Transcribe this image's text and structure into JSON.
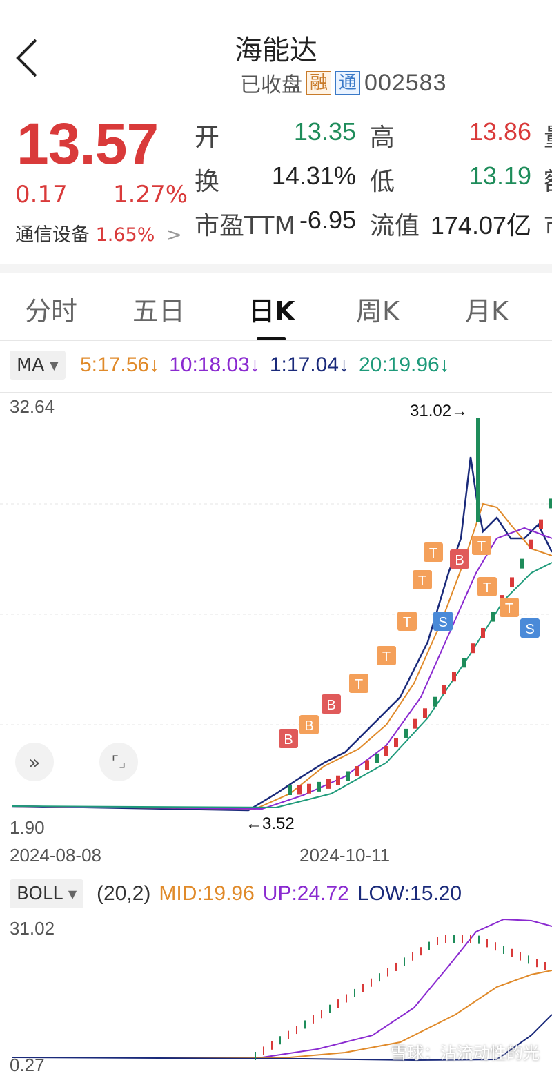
{
  "header": {
    "title": "海能达",
    "status": "已收盘",
    "tag_rong": "融",
    "tag_tong": "通",
    "code": "002583"
  },
  "quote": {
    "price": "13.57",
    "change": "0.17",
    "change_pct": "1.27%",
    "sector_name": "通信设备",
    "sector_pct": "1.65%",
    "sector_arrow": ">",
    "rows": [
      {
        "l1": "开",
        "v1": "13.35",
        "c1": "green",
        "l2": "高",
        "v2": "13.86",
        "c2": "red",
        "l3": "量"
      },
      {
        "l1": "换",
        "v1": "14.31%",
        "c1": "dark",
        "l2": "低",
        "v2": "13.19",
        "c2": "green",
        "l3": "额"
      },
      {
        "l1": "市盈TTM",
        "v1": "-6.95",
        "c1": "dark",
        "l2": "流值",
        "v2": "174.07亿",
        "c2": "dark",
        "l3": "市"
      }
    ]
  },
  "tabs": [
    "分时",
    "五日",
    "日K",
    "周K",
    "月K"
  ],
  "active_tab": "日K",
  "ma": {
    "label": "MA",
    "items": [
      {
        "text": "5:17.56↓",
        "color": "#e08a2a"
      },
      {
        "text": "10:18.03↓",
        "color": "#8a2ad0"
      },
      {
        "text": "1:17.04↓",
        "color": "#1a2a7a"
      },
      {
        "text": "20:19.96↓",
        "color": "#1e9a7a"
      }
    ]
  },
  "main_chart": {
    "y_max": "32.64",
    "y_min": "1.90",
    "high_mark": "31.02→",
    "low_mark": "←3.52",
    "date_left": "2024-08-08",
    "date_mid": "2024-10-11"
  },
  "controls": {
    "expand": "»",
    "fullscreen": "⌜⌟"
  },
  "boll": {
    "label": "BOLL",
    "param": "(20,2)",
    "items": [
      {
        "text": "MID:19.96",
        "color": "#e08a2a"
      },
      {
        "text": "UP:24.72",
        "color": "#8a2ad0"
      },
      {
        "text": "LOW:15.20",
        "color": "#1a2a7a"
      }
    ],
    "y_max": "31.02",
    "y_min": "0.27"
  },
  "watermark": "雪球：沾流动性的光",
  "colors": {
    "up": "#d93a3a",
    "down": "#1e8c5a",
    "trade_t": "#f4a05a",
    "trade_b": "#e05a5a",
    "trade_s": "#4a8ad8"
  }
}
